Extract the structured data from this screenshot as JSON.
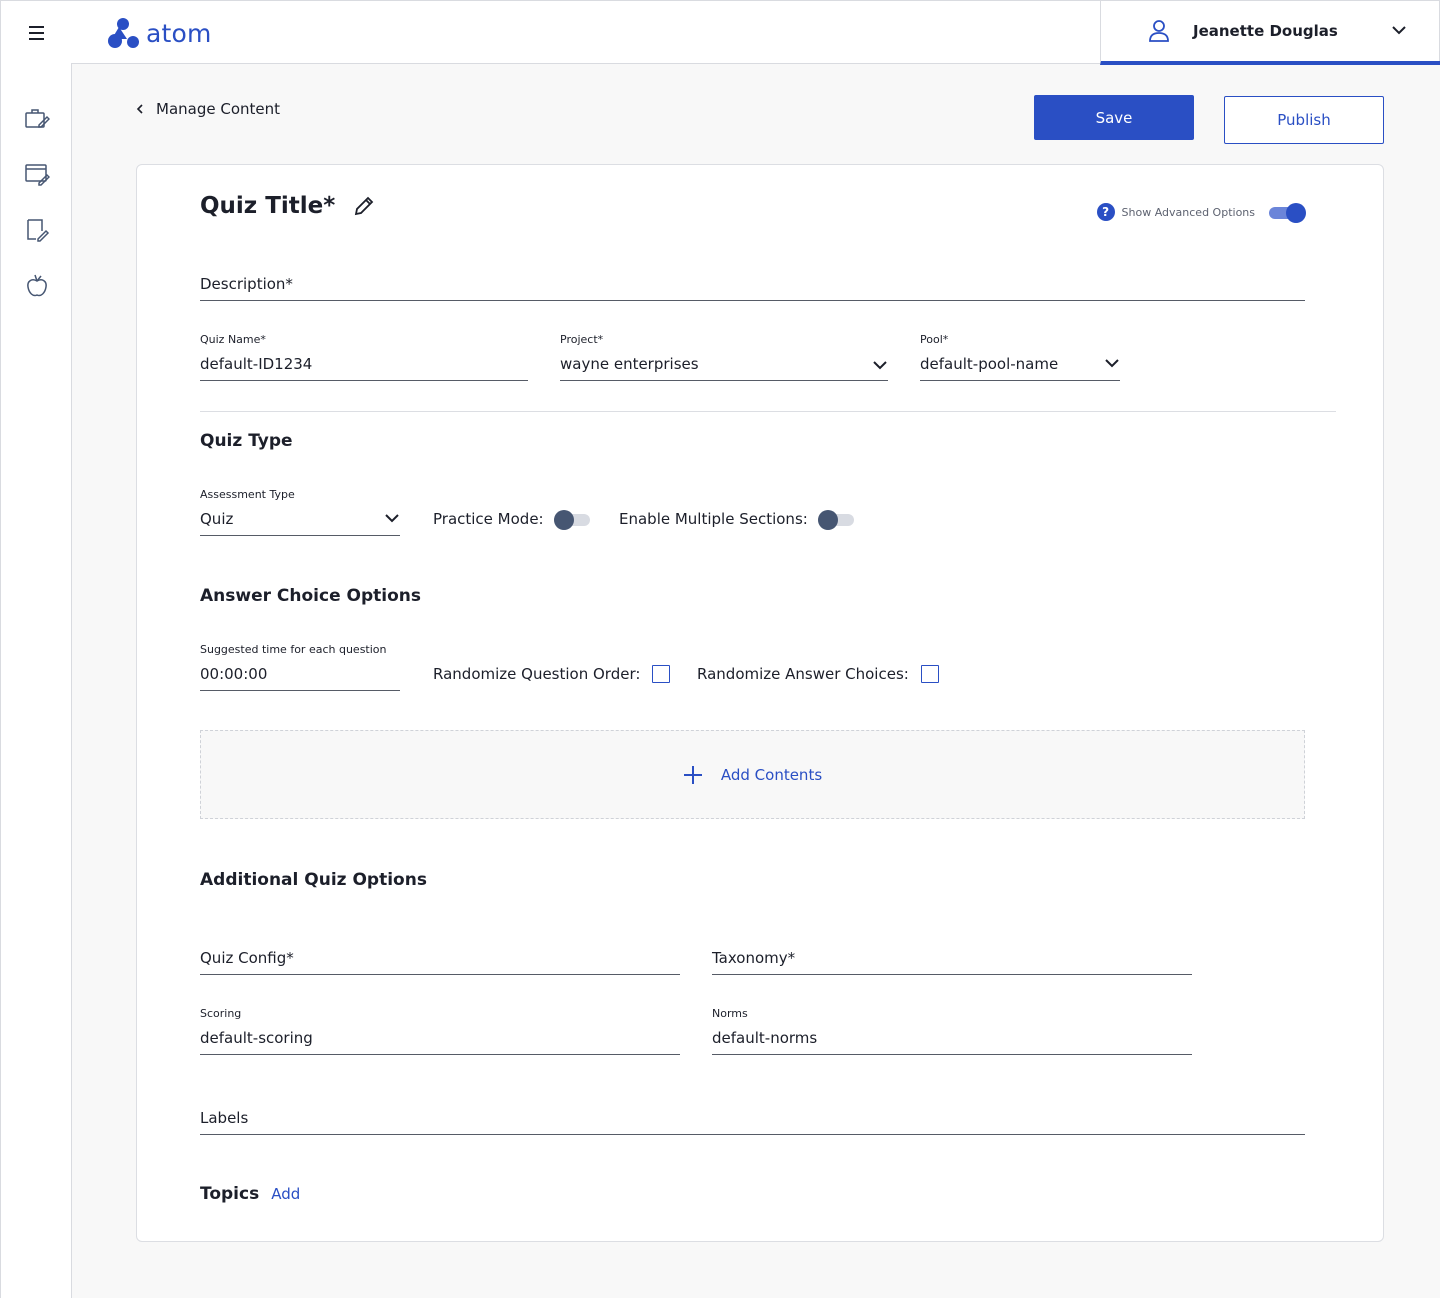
{
  "app": {
    "logo_text": "atom",
    "brand_color": "#2a4fc4"
  },
  "user": {
    "name": "Jeanette Douglas"
  },
  "nav": {
    "icons": [
      "briefcase-edit-icon",
      "browser-edit-icon",
      "document-edit-icon",
      "apple-icon"
    ]
  },
  "breadcrumb": {
    "label": "Manage Content"
  },
  "actions": {
    "save_label": "Save",
    "publish_label": "Publish"
  },
  "quiz": {
    "title": "Quiz Title*",
    "advanced_options_label": "Show Advanced Options",
    "advanced_options_on": true,
    "description_placeholder": "Description*",
    "quiz_name": {
      "label": "Quiz Name*",
      "value": "default-ID1234"
    },
    "project": {
      "label": "Project*",
      "value": "wayne enterprises"
    },
    "pool": {
      "label": "Pool*",
      "value": "default-pool-name"
    }
  },
  "quiz_type": {
    "heading": "Quiz Type",
    "assessment_type": {
      "label": "Assessment Type",
      "value": "Quiz"
    },
    "practice_mode_label": "Practice Mode:",
    "practice_mode_on": false,
    "multiple_sections_label": "Enable Multiple Sections:",
    "multiple_sections_on": false
  },
  "answer_choice": {
    "heading": "Answer Choice Options",
    "suggested_time": {
      "label": "Suggested time for each question",
      "value": "00:00:00"
    },
    "randomize_question_label": "Randomize Question Order:",
    "randomize_question_checked": false,
    "randomize_answer_label": "Randomize Answer Choices:",
    "randomize_answer_checked": false
  },
  "add_contents": {
    "label": "Add Contents"
  },
  "additional": {
    "heading": "Additional Quiz Options",
    "quiz_config_placeholder": "Quiz Config*",
    "taxonomy_placeholder": "Taxonomy*",
    "scoring": {
      "label": "Scoring",
      "value": "default-scoring"
    },
    "norms": {
      "label": "Norms",
      "value": "default-norms"
    },
    "labels_placeholder": "Labels"
  },
  "topics": {
    "heading": "Topics",
    "add_label": "Add"
  }
}
